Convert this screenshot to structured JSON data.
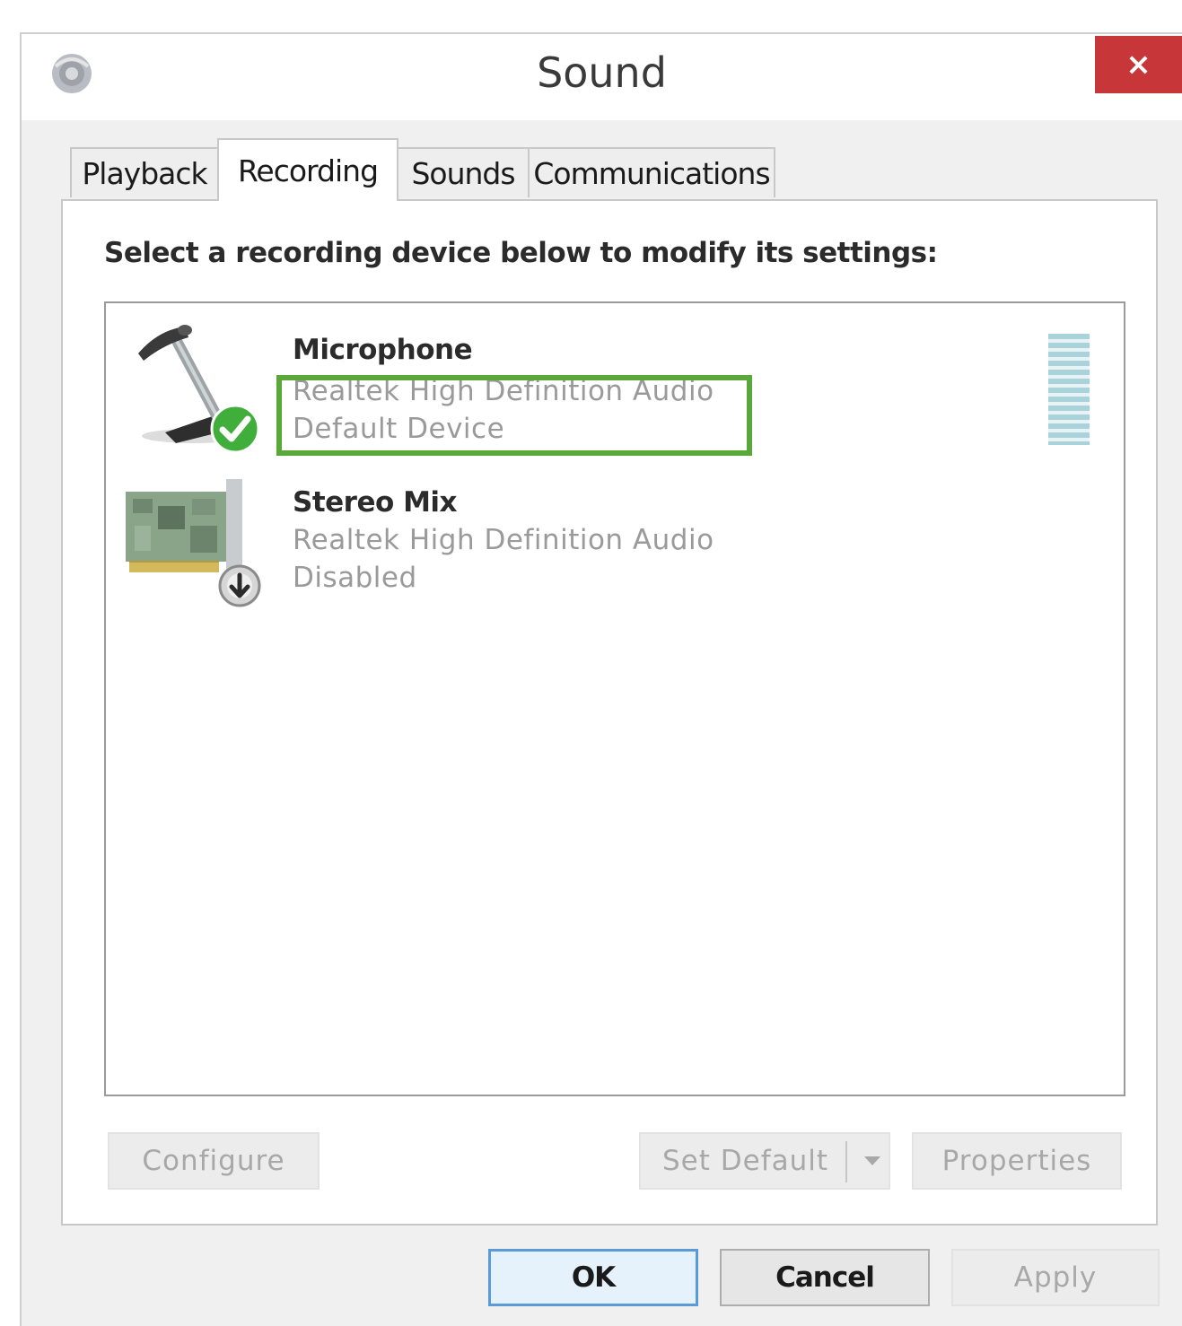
{
  "window": {
    "title": "Sound",
    "close_label": "×"
  },
  "tabs": [
    {
      "label": "Playback",
      "active": false
    },
    {
      "label": "Recording",
      "active": true
    },
    {
      "label": "Sounds",
      "active": false
    },
    {
      "label": "Communications",
      "active": false
    }
  ],
  "recording": {
    "instruction": "Select a recording device below to modify its settings:",
    "devices": [
      {
        "name": "Microphone",
        "driver": "Realtek High Definition Audio",
        "status": "Default Device",
        "icon": "microphone-icon",
        "badge": "default-check-icon",
        "highlighted": true,
        "has_level_meter": true
      },
      {
        "name": "Stereo Mix",
        "driver": "Realtek High Definition Audio",
        "status": "Disabled",
        "icon": "sound-card-icon",
        "badge": "disabled-down-arrow-icon",
        "highlighted": false,
        "has_level_meter": false
      }
    ],
    "buttons": {
      "configure": "Configure",
      "set_default": "Set Default",
      "properties": "Properties"
    }
  },
  "dialog_buttons": {
    "ok": "OK",
    "cancel": "Cancel",
    "apply": "Apply"
  },
  "colors": {
    "close_button": "#c7373a",
    "highlight_border": "#5aa839",
    "default_badge": "#3fae3a",
    "level_meter": "#a9d2da"
  }
}
